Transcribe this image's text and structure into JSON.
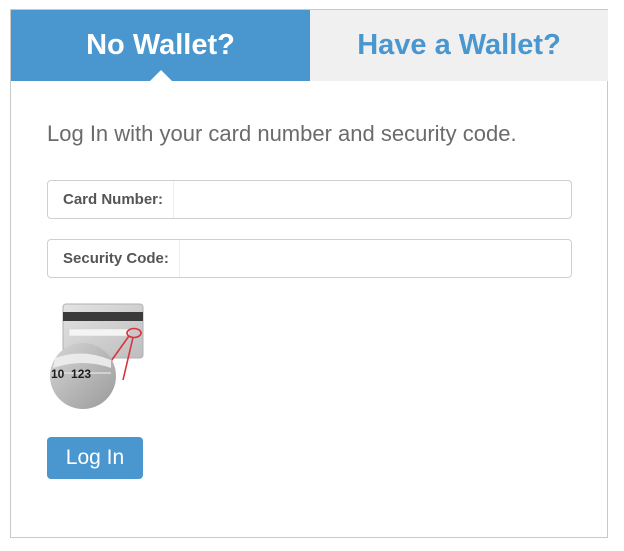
{
  "tabs": {
    "no_wallet": "No Wallet?",
    "have_wallet": "Have a Wallet?"
  },
  "instructions": "Log In with your card number and security code.",
  "fields": {
    "card_number": {
      "label": "Card Number:",
      "value": "",
      "placeholder": ""
    },
    "security_code": {
      "label": "Security Code:",
      "value": "",
      "placeholder": ""
    }
  },
  "illustration": {
    "number_text": "10  123",
    "icon": "card-security-code-icon"
  },
  "buttons": {
    "login": "Log In"
  },
  "colors": {
    "accent": "#4a97d0",
    "inactive_tab_bg": "#f0f0f0",
    "text_muted": "#6b6b6b",
    "highlight_red": "#d9333f"
  }
}
